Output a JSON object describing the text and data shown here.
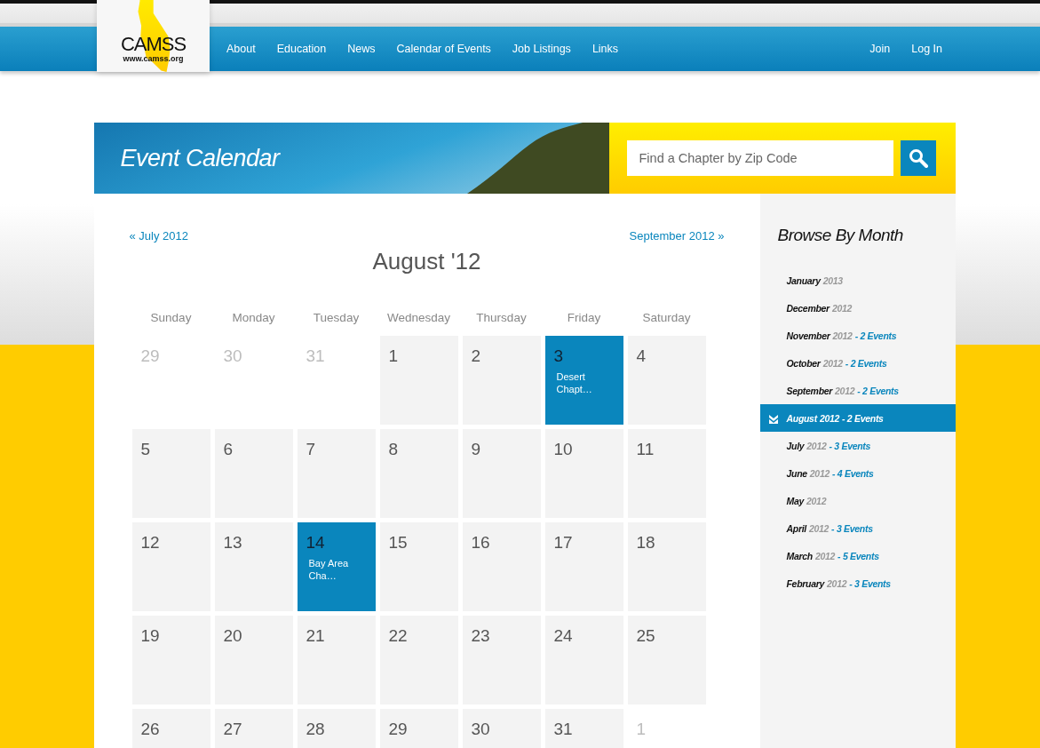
{
  "logo": {
    "name": "CAMSS",
    "url": "www.camss.org"
  },
  "nav": {
    "items": [
      "About",
      "Education",
      "News",
      "Calendar of Events",
      "Job Listings",
      "Links"
    ],
    "account": [
      "Join",
      "Log In"
    ]
  },
  "banner": {
    "title": "Event Calendar",
    "search": {
      "placeholder": "Find a Chapter by Zip Code"
    }
  },
  "calendar": {
    "prev": "« July 2012",
    "next": "September 2012 »",
    "title": "August '12",
    "weekdays": [
      "Sunday",
      "Monday",
      "Tuesday",
      "Wednesday",
      "Thursday",
      "Friday",
      "Saturday"
    ],
    "weeks": [
      [
        {
          "day": "29",
          "kind": "other"
        },
        {
          "day": "30",
          "kind": "other"
        },
        {
          "day": "31",
          "kind": "other"
        },
        {
          "day": "1",
          "kind": "current"
        },
        {
          "day": "2",
          "kind": "current"
        },
        {
          "day": "3",
          "kind": "current",
          "event": "Desert Chapt…"
        },
        {
          "day": "4",
          "kind": "current"
        }
      ],
      [
        {
          "day": "5",
          "kind": "current"
        },
        {
          "day": "6",
          "kind": "current"
        },
        {
          "day": "7",
          "kind": "current"
        },
        {
          "day": "8",
          "kind": "current"
        },
        {
          "day": "9",
          "kind": "current"
        },
        {
          "day": "10",
          "kind": "current"
        },
        {
          "day": "11",
          "kind": "current"
        }
      ],
      [
        {
          "day": "12",
          "kind": "current"
        },
        {
          "day": "13",
          "kind": "current"
        },
        {
          "day": "14",
          "kind": "current",
          "event": "Bay Area Cha…"
        },
        {
          "day": "15",
          "kind": "current"
        },
        {
          "day": "16",
          "kind": "current"
        },
        {
          "day": "17",
          "kind": "current"
        },
        {
          "day": "18",
          "kind": "current"
        }
      ],
      [
        {
          "day": "19",
          "kind": "current"
        },
        {
          "day": "20",
          "kind": "current"
        },
        {
          "day": "21",
          "kind": "current"
        },
        {
          "day": "22",
          "kind": "current"
        },
        {
          "day": "23",
          "kind": "current"
        },
        {
          "day": "24",
          "kind": "current"
        },
        {
          "day": "25",
          "kind": "current"
        }
      ],
      [
        {
          "day": "26",
          "kind": "current"
        },
        {
          "day": "27",
          "kind": "current"
        },
        {
          "day": "28",
          "kind": "current"
        },
        {
          "day": "29",
          "kind": "current"
        },
        {
          "day": "30",
          "kind": "current"
        },
        {
          "day": "31",
          "kind": "current"
        },
        {
          "day": "1",
          "kind": "other"
        }
      ]
    ]
  },
  "browse": {
    "title": "Browse By Month",
    "months": [
      {
        "month": "January",
        "year": "2013",
        "selected": false
      },
      {
        "month": "December",
        "year": "2012",
        "selected": false
      },
      {
        "month": "November",
        "year": "2012",
        "events": "- 2 Events",
        "selected": false
      },
      {
        "month": "October",
        "year": "2012",
        "events": "- 2 Events",
        "selected": false
      },
      {
        "month": "September",
        "year": "2012",
        "events": "- 2 Events",
        "selected": false
      },
      {
        "month": "August",
        "year": "2012",
        "events": "- 2 Events",
        "selected": true
      },
      {
        "month": "July",
        "year": "2012",
        "events": "- 3 Events",
        "selected": false
      },
      {
        "month": "June",
        "year": "2012",
        "events": "- 4 Events",
        "selected": false
      },
      {
        "month": "May",
        "year": "2012",
        "selected": false
      },
      {
        "month": "April",
        "year": "2012",
        "events": "- 3 Events",
        "selected": false
      },
      {
        "month": "March",
        "year": "2012",
        "events": "- 5 Events",
        "selected": false
      },
      {
        "month": "February",
        "year": "2012",
        "events": "- 3 Events",
        "selected": false
      }
    ]
  }
}
